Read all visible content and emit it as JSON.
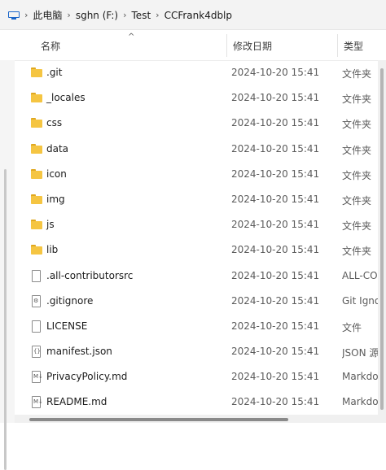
{
  "breadcrumb": {
    "items": [
      "此电脑",
      "sghn (F:)",
      "Test",
      "CCFrank4dblp"
    ],
    "separator": "›"
  },
  "columns": {
    "name": "名称",
    "date": "修改日期",
    "type": "类型",
    "sort_indicator": "^"
  },
  "files": [
    {
      "name": ".git",
      "date": "2024-10-20 15:41",
      "type": "文件夹",
      "icon": "folder-icon"
    },
    {
      "name": "_locales",
      "date": "2024-10-20 15:41",
      "type": "文件夹",
      "icon": "folder-icon"
    },
    {
      "name": "css",
      "date": "2024-10-20 15:41",
      "type": "文件夹",
      "icon": "folder-icon"
    },
    {
      "name": "data",
      "date": "2024-10-20 15:41",
      "type": "文件夹",
      "icon": "folder-icon"
    },
    {
      "name": "icon",
      "date": "2024-10-20 15:41",
      "type": "文件夹",
      "icon": "folder-icon"
    },
    {
      "name": "img",
      "date": "2024-10-20 15:41",
      "type": "文件夹",
      "icon": "folder-icon"
    },
    {
      "name": "js",
      "date": "2024-10-20 15:41",
      "type": "文件夹",
      "icon": "folder-icon"
    },
    {
      "name": "lib",
      "date": "2024-10-20 15:41",
      "type": "文件夹",
      "icon": "folder-icon"
    },
    {
      "name": ".all-contributorsrc",
      "date": "2024-10-20 15:41",
      "type": "ALL-CO",
      "icon": "file-icon"
    },
    {
      "name": ".gitignore",
      "date": "2024-10-20 15:41",
      "type": "Git Igno",
      "icon": "gear-file-icon"
    },
    {
      "name": "LICENSE",
      "date": "2024-10-20 15:41",
      "type": "文件",
      "icon": "file-icon"
    },
    {
      "name": "manifest.json",
      "date": "2024-10-20 15:41",
      "type": "JSON 源",
      "icon": "json-file-icon"
    },
    {
      "name": "PrivacyPolicy.md",
      "date": "2024-10-20 15:41",
      "type": "Markdo",
      "icon": "markdown-file-icon"
    },
    {
      "name": "README.md",
      "date": "2024-10-20 15:41",
      "type": "Markdo",
      "icon": "markdown-file-icon"
    }
  ]
}
